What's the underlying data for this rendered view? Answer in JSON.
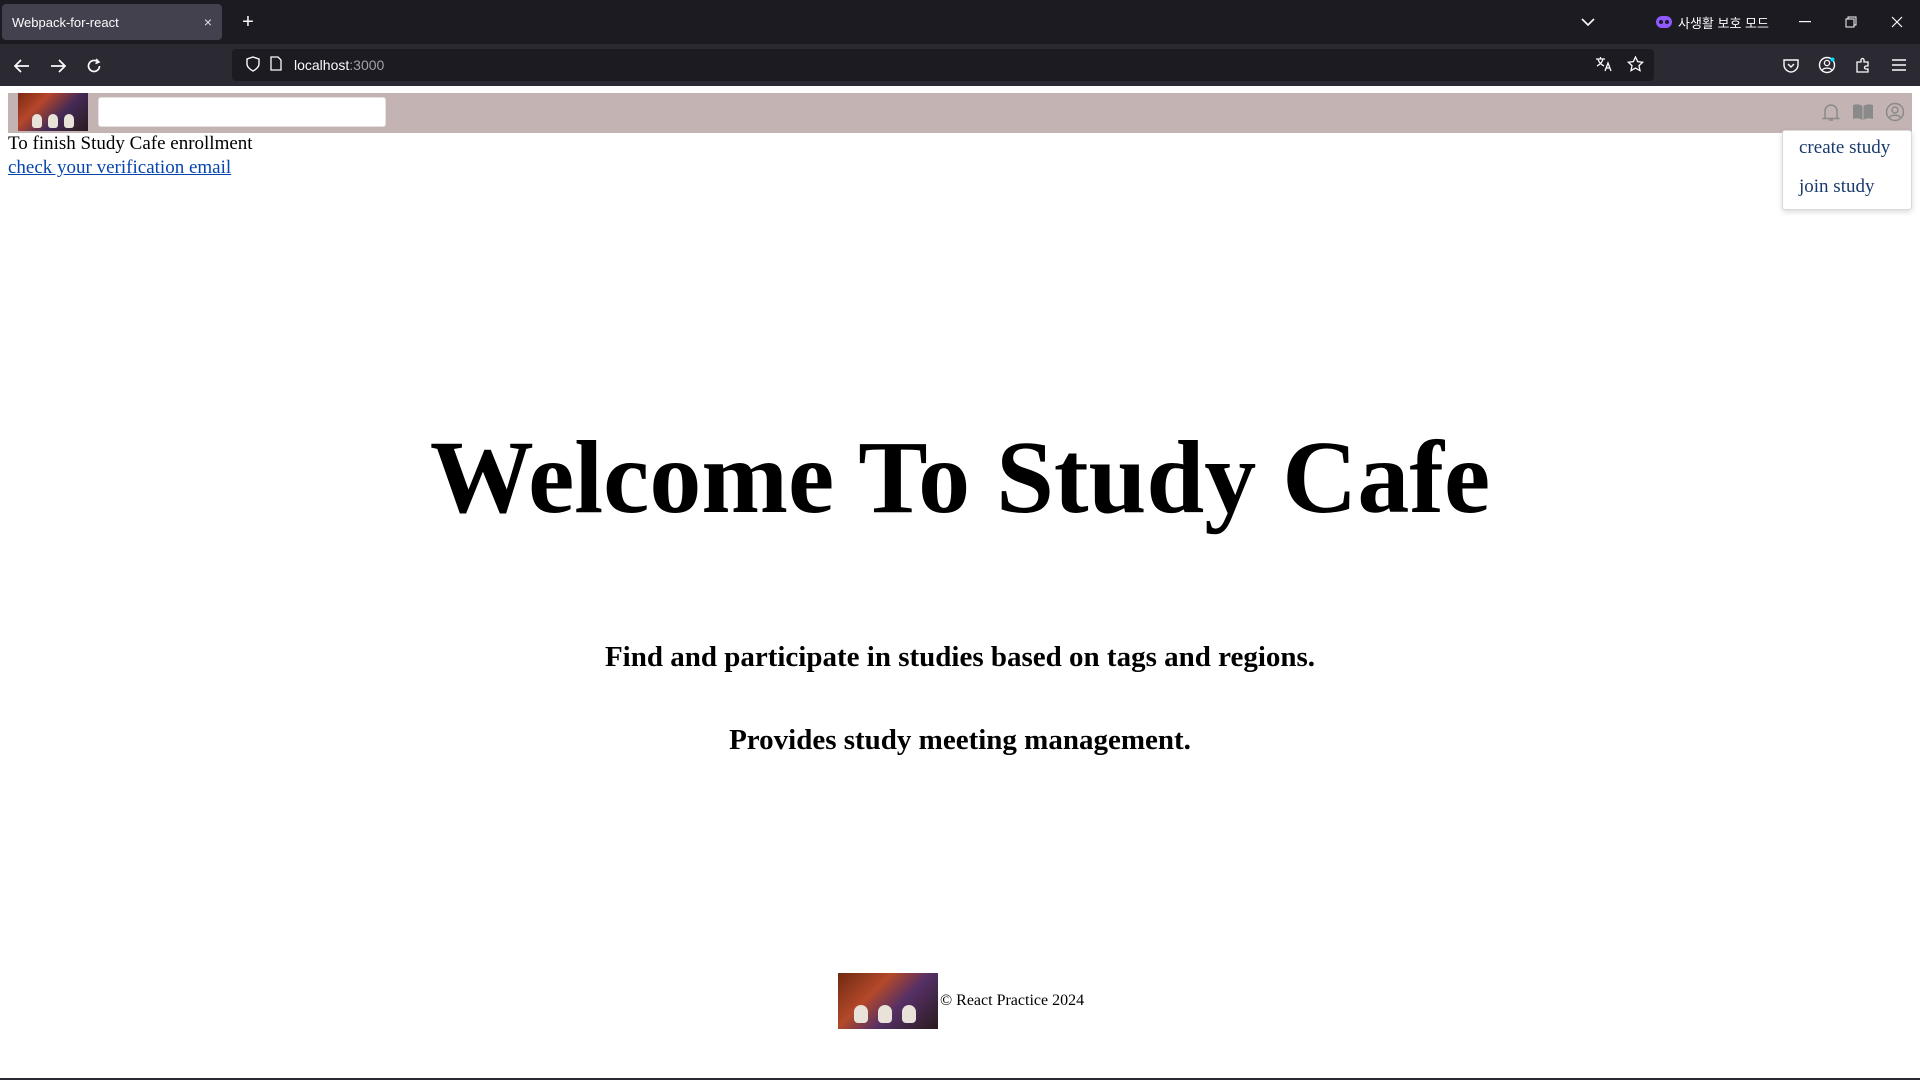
{
  "browser": {
    "tab_title": "Webpack-for-react",
    "tab_close": "×",
    "new_tab": "+",
    "private_mode_label": "사생활 보호 모드",
    "url_host": "localhost",
    "url_port": ":3000"
  },
  "header": {
    "search_placeholder": "",
    "icons": [
      "bell-icon",
      "book-icon",
      "user-circle-icon"
    ]
  },
  "dropdown": {
    "items": [
      {
        "label": "create study"
      },
      {
        "label": "join study"
      }
    ]
  },
  "notice": {
    "text": "To finish Study Cafe enrollment",
    "link": "check your verification email"
  },
  "hero": {
    "title": "Welcome To Study Cafe",
    "subtitle1": "Find and participate in studies based on tags and regions.",
    "subtitle2": "Provides study meeting management."
  },
  "footer": {
    "text": "© React Practice 2024"
  }
}
